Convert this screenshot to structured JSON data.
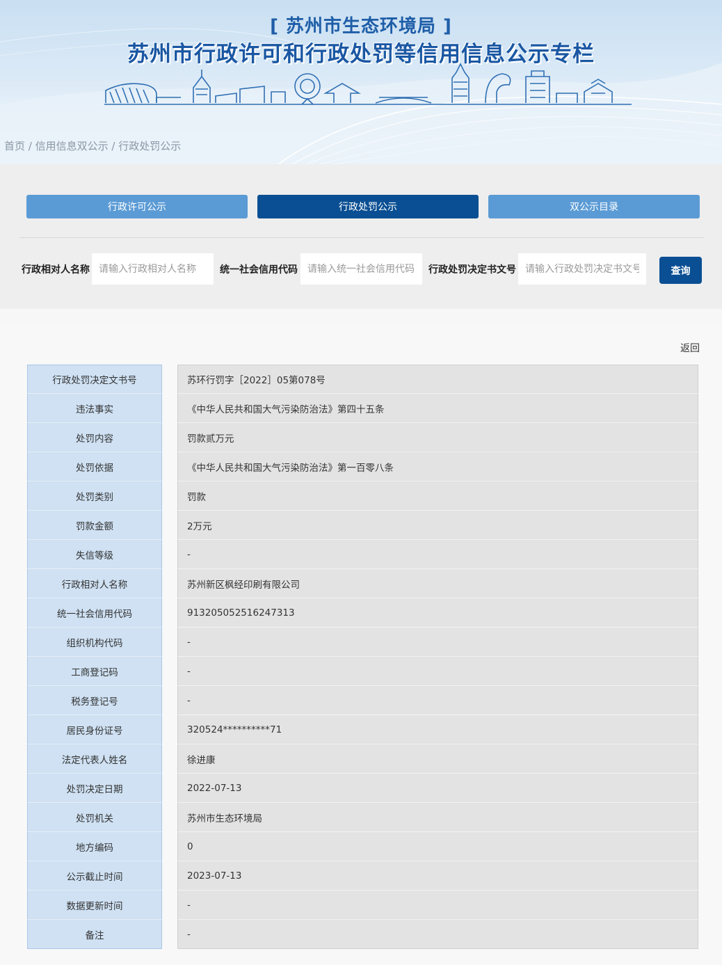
{
  "header": {
    "subtitle": "[ 苏州市生态环境局 ]",
    "title": "苏州市行政许可和行政处罚等信用信息公示专栏"
  },
  "breadcrumb": {
    "home": "首页",
    "sep1": " / ",
    "level1": "信用信息双公示",
    "sep2": " / ",
    "current": "行政处罚公示"
  },
  "tabs": {
    "license": "行政许可公示",
    "penalty": "行政处罚公示",
    "catalog": "双公示目录"
  },
  "search": {
    "name_label": "行政相对人名称",
    "name_placeholder": "请输入行政相对人名称",
    "code_label": "统一社会信用代码",
    "code_placeholder": "请输入统一社会信用代码",
    "doc_label": "行政处罚决定书文号",
    "doc_placeholder": "请输入行政处罚决定书文号",
    "button": "查询"
  },
  "back": "返回",
  "rows": [
    {
      "label": "行政处罚决定文书号",
      "value": "苏环行罚字［2022］05第078号"
    },
    {
      "label": "违法事实",
      "value": "《中华人民共和国大气污染防治法》第四十五条"
    },
    {
      "label": "处罚内容",
      "value": "罚款贰万元"
    },
    {
      "label": "处罚依据",
      "value": "《中华人民共和国大气污染防治法》第一百零八条"
    },
    {
      "label": "处罚类别",
      "value": "罚款"
    },
    {
      "label": "罚款金额",
      "value": "2万元"
    },
    {
      "label": "失信等级",
      "value": "-"
    },
    {
      "label": "行政相对人名称",
      "value": "苏州新区枫经印刷有限公司"
    },
    {
      "label": "统一社会信用代码",
      "value": "913205052516247313"
    },
    {
      "label": "组织机构代码",
      "value": "-"
    },
    {
      "label": "工商登记码",
      "value": "-"
    },
    {
      "label": "税务登记号",
      "value": "-"
    },
    {
      "label": "居民身份证号",
      "value": "320524**********71"
    },
    {
      "label": "法定代表人姓名",
      "value": "徐进康"
    },
    {
      "label": "处罚决定日期",
      "value": "2022-07-13"
    },
    {
      "label": "处罚机关",
      "value": "苏州市生态环境局"
    },
    {
      "label": "地方编码",
      "value": "0"
    },
    {
      "label": "公示截止时间",
      "value": "2023-07-13"
    },
    {
      "label": "数据更新时间",
      "value": "-"
    },
    {
      "label": "备注",
      "value": "-"
    }
  ]
}
